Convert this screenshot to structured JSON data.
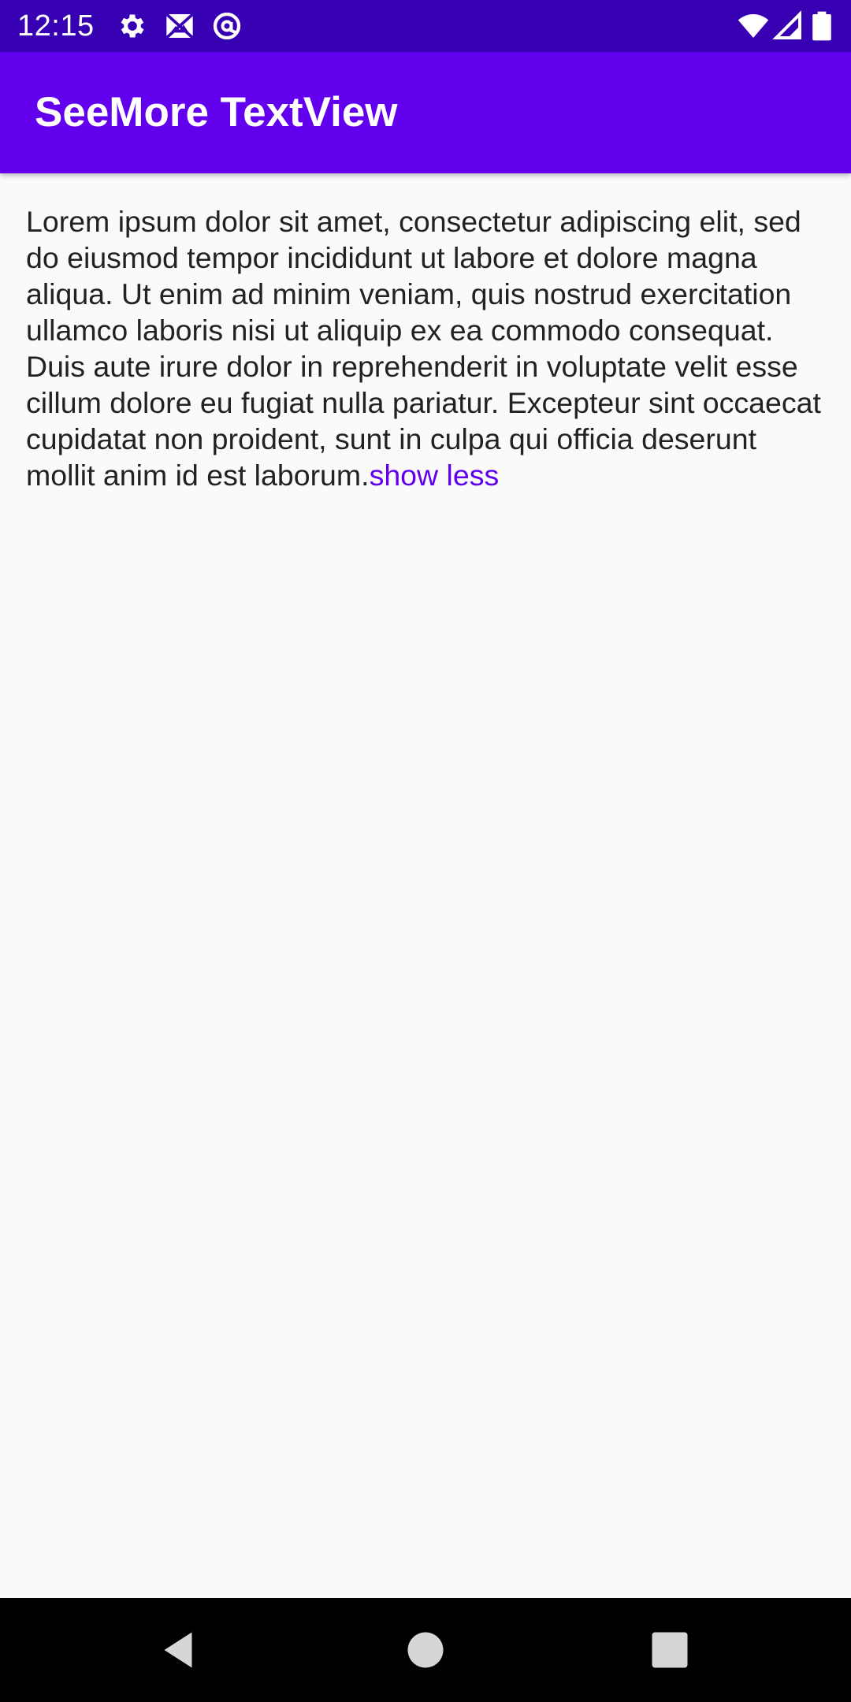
{
  "status_bar": {
    "time": "12:15",
    "icons": [
      "gear-icon",
      "image-off-icon",
      "at-sign-icon",
      "wifi-icon",
      "signal-icon",
      "battery-icon"
    ],
    "background": "#3700b3"
  },
  "app_bar": {
    "title": "SeeMore TextView",
    "background": "#6200ee"
  },
  "content": {
    "text": "Lorem ipsum dolor sit amet, consectetur adipiscing elit, sed do eiusmod tempor incididunt ut labore et dolore magna aliqua. Ut enim ad minim veniam, quis nostrud exercitation ullamco laboris nisi ut aliquip ex ea commodo consequat. Duis aute irure dolor in reprehenderit in voluptate velit esse cillum dolore eu fugiat nulla pariatur. Excepteur sint occaecat cupidatat non proident, sunt in culpa qui officia deserunt mollit anim id est laborum.",
    "toggle_label": "show less",
    "link_color": "#6200ee"
  },
  "nav_bar": {
    "buttons": [
      "back-icon",
      "home-icon",
      "recents-icon"
    ]
  }
}
